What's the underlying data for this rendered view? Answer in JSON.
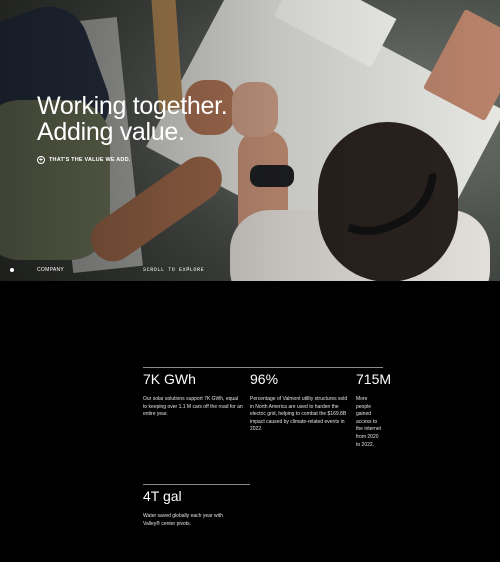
{
  "hero": {
    "title_line1": "Working together.",
    "title_line2": "Adding value.",
    "cta_label": "THAT'S THE VALUE WE ADD.",
    "cta_icon": "plus-circle-icon",
    "company_label": "COMPANY",
    "scroll_label": "SCROLL TO EXPLORE",
    "scroll_icon": "↓"
  },
  "stats": [
    {
      "value": "7K GWh",
      "description": "Our solar solutions support 7K GWh, equal to keeping over 1.1 M cars off the road for an entire year."
    },
    {
      "value": "96%",
      "description": "Percentage of Valmont utility structures sold in North America are used to harden the electric grid, helping to combat the $169.8B impact caused by climate-related events in 2022."
    },
    {
      "value": "715M",
      "description": "More people gained access to the internet from 2020 to 2022."
    },
    {
      "value": "4T gal",
      "description": "Water saved globally each year with Valley® center pivots."
    }
  ]
}
